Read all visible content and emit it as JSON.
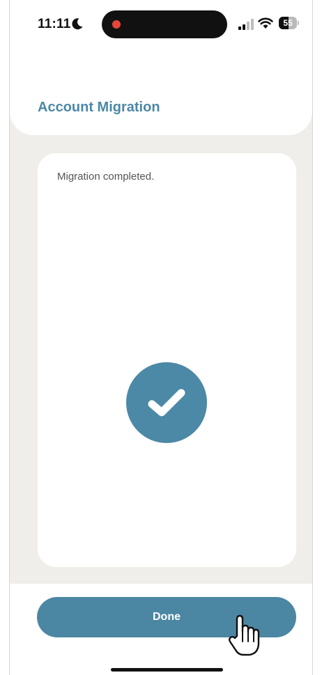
{
  "status_bar": {
    "time": "11:11",
    "battery_level": "55",
    "battery_fraction": 0.55,
    "focus_icon": "moon-icon",
    "recording_color": "#e8453a"
  },
  "header": {
    "title": "Account Migration"
  },
  "card": {
    "message": "Migration completed.",
    "status_icon": "checkmark-circle-icon"
  },
  "footer": {
    "done_label": "Done"
  },
  "colors": {
    "accent": "#4b88a6",
    "background": "#efeeeb",
    "surface": "#ffffff",
    "text_secondary": "#555555"
  }
}
